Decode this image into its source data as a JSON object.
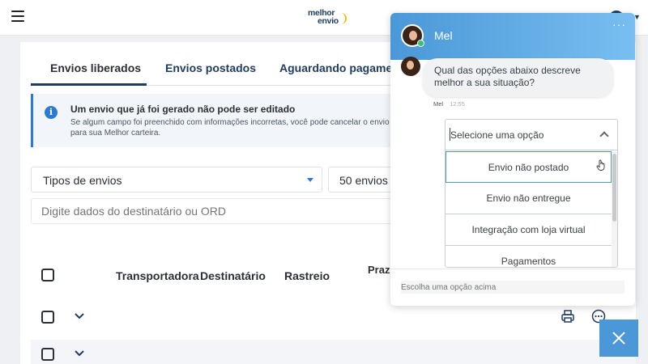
{
  "header": {
    "logo_top": "melhor",
    "logo_bottom": "envio"
  },
  "tabs": [
    "Envios liberados",
    "Envios postados",
    "Aguardando pagamento"
  ],
  "alert": {
    "title": "Um envio que já foi gerado não pode ser editado",
    "line1": "Se algum campo foi preenchido com informações incorretas, você pode cancelar o envio e gerar u",
    "line2": "para sua Melhor carteira."
  },
  "filters": {
    "type_select": "Tipos de envios",
    "count_select": "50 envios",
    "search_placeholder": "Digite dados do destinatário ou ORD"
  },
  "table": {
    "headers": [
      "Transportadora",
      "Destinatário",
      "Rastreio",
      "Prazo expir"
    ]
  },
  "chat": {
    "agent_name": "Mel",
    "header_menu": "···",
    "message_line1": "Qual das opções abaixo descreve",
    "message_line2": "melhor a sua situação?",
    "sender": "Mel",
    "time": "12:55",
    "select_placeholder": "Selecione uma opção",
    "options": [
      "Envio não postado",
      "Envio não entregue",
      "Integração com loja virtual",
      "Pagamentos"
    ],
    "input_placeholder": "Escolha uma opção acima"
  },
  "colors": {
    "brand_navy": "#1f3d63",
    "accent_blue": "#4a98d8",
    "info_blue": "#2b7bd6"
  }
}
